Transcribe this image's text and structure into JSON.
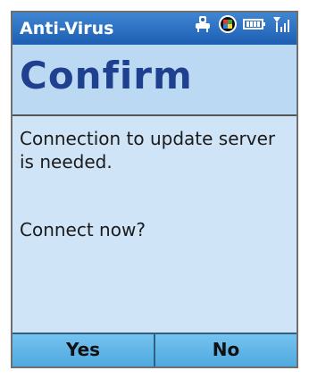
{
  "app": {
    "title": "Anti-Virus"
  },
  "status": {
    "icons": [
      "connectivity-icon",
      "windows-start-icon",
      "battery-icon",
      "signal-icon"
    ]
  },
  "dialog": {
    "title": "Confirm",
    "message": "Connection to update server is needed.",
    "question": "Connect now?"
  },
  "softkeys": {
    "left_label": "Yes",
    "right_label": "No"
  },
  "colors": {
    "titlebar": "#1d5fb3",
    "header_text": "#1f3f8f",
    "screen_bg": "#cfe4f7",
    "softkey_bg": "#4fa9df"
  }
}
